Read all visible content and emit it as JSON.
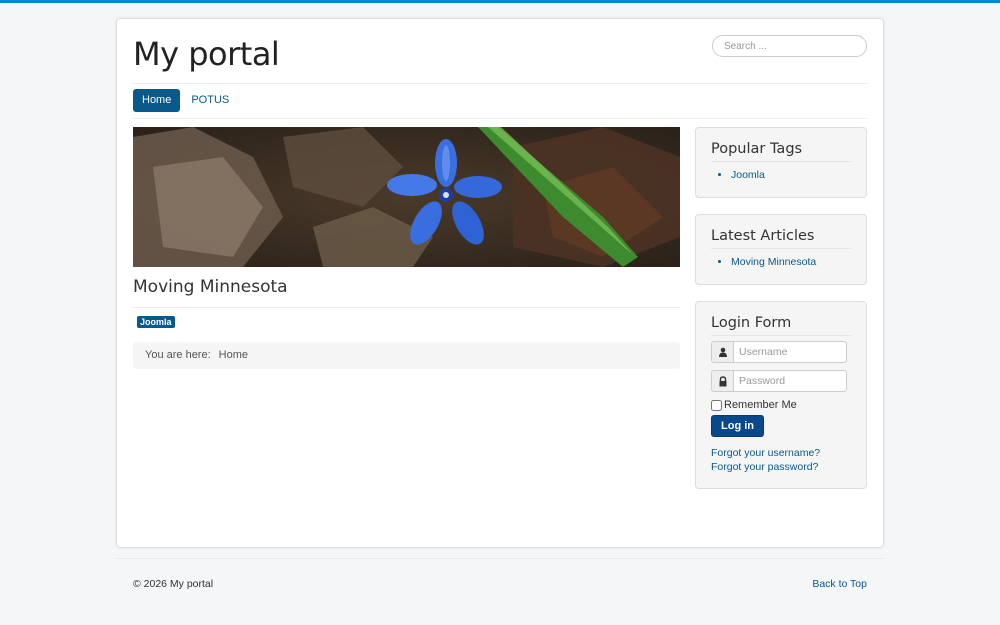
{
  "header": {
    "brand": "My portal",
    "search_placeholder": "Search ..."
  },
  "nav": {
    "items": [
      {
        "label": "Home",
        "active": true
      },
      {
        "label": "POTUS",
        "active": false
      }
    ]
  },
  "article": {
    "title": "Moving Minnesota",
    "tag": "Joomla"
  },
  "breadcrumb": {
    "prefix": "You are here:",
    "current": "Home"
  },
  "sidebar": {
    "popular_tags": {
      "title": "Popular Tags",
      "items": [
        "Joomla"
      ]
    },
    "latest_articles": {
      "title": "Latest Articles",
      "items": [
        "Moving Minnesota"
      ]
    },
    "login": {
      "title": "Login Form",
      "username_placeholder": "Username",
      "password_placeholder": "Password",
      "remember_label": "Remember Me",
      "button_label": "Log in",
      "forgot_username": "Forgot your username?",
      "forgot_password": "Forgot your password?"
    }
  },
  "footer": {
    "copyright": "© 2026 My portal",
    "back_to_top": "Back to Top"
  },
  "colors": {
    "accent": "#08598c",
    "top_bar": "#0088cc",
    "page_bg": "#f4f6f7"
  }
}
